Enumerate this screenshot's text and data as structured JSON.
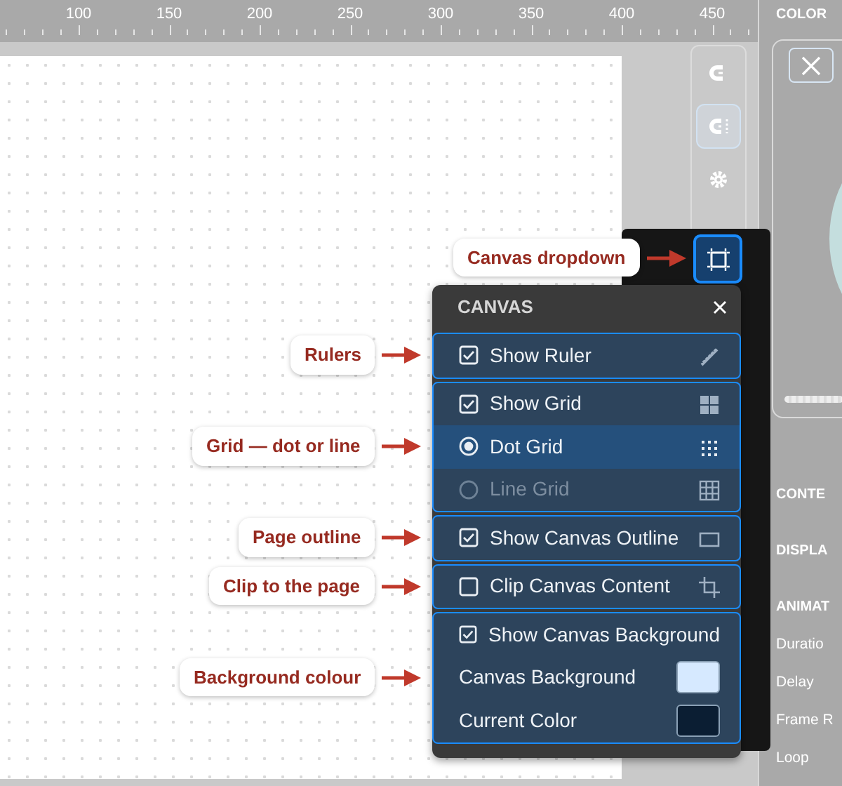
{
  "ruler": {
    "labels": [
      "100",
      "150",
      "200",
      "250",
      "300",
      "350",
      "400",
      "450"
    ]
  },
  "tools": [
    {
      "kind": "magnet",
      "selected": false
    },
    {
      "kind": "magnet-grid",
      "selected": true
    },
    {
      "kind": "gear",
      "selected": false
    }
  ],
  "canvas_button": {
    "selected": true,
    "callout": "Canvas dropdown"
  },
  "side_panel": {
    "title": "COLOR",
    "sections": [
      "CONTE",
      "DISPLA",
      "ANIMAT"
    ],
    "fields": [
      "Duratio",
      "Delay",
      "Frame R",
      "Loop"
    ]
  },
  "canvas_menu": {
    "title": "CANVAS",
    "groups": [
      {
        "callout": "Rulers",
        "rows": [
          {
            "kind": "checkbox",
            "label": "Show Ruler",
            "checked": true
          }
        ]
      },
      {
        "callout": "Grid — dot or line",
        "rows": [
          {
            "kind": "checkbox",
            "label": "Show Grid",
            "checked": true
          },
          {
            "kind": "radio",
            "label": "Dot Grid",
            "selected": true,
            "disabled": false
          },
          {
            "kind": "radio",
            "label": "Line Grid",
            "selected": false,
            "disabled": true
          }
        ]
      },
      {
        "callout": "Page outline",
        "rows": [
          {
            "kind": "checkbox",
            "label": "Show Canvas Outline",
            "checked": true
          }
        ]
      },
      {
        "callout": "Clip to the page",
        "rows": [
          {
            "kind": "checkbox",
            "label": "Clip Canvas Content",
            "checked": false
          }
        ]
      },
      {
        "callout": "Background colour",
        "rows": [
          {
            "kind": "checkbox",
            "label": "Show Canvas Background",
            "checked": true
          },
          {
            "kind": "color",
            "label": "Canvas Background",
            "color": "#d6e9ff"
          },
          {
            "kind": "color",
            "label": "Current Color",
            "color": "#0b1e33"
          }
        ]
      }
    ]
  }
}
